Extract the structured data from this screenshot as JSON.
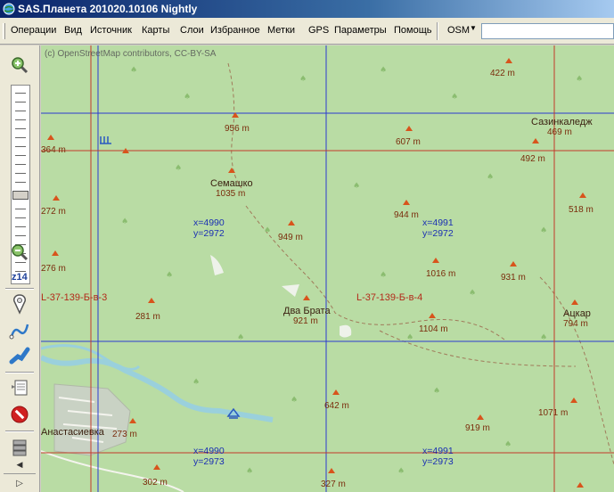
{
  "window": {
    "title": "SAS.Планета 201020.10106 Nightly"
  },
  "menu": {
    "items": [
      "Операции",
      "Вид",
      "Источник",
      "Карты",
      "Слои",
      "Избранное",
      "Метки",
      "GPS",
      "Параметры",
      "Помощь"
    ],
    "map_source": "OSM",
    "search_placeholder": ""
  },
  "toolbar": {
    "zoom_level": "z14",
    "buttons": [
      "zoom-in-icon",
      "zoom-out-icon",
      "marker-icon",
      "path-icon",
      "measure-icon",
      "notes-icon",
      "forbidden-icon",
      "layers-icon"
    ]
  },
  "map": {
    "attribution": "(c) OpenStreetMap contributors, CC-BY-SA",
    "colors": {
      "land": "#b9dca4",
      "grid_blue": "#2a3ad0",
      "grid_red": "#c23a2a",
      "peak": "#d8541c",
      "water": "#9ad0dc"
    },
    "elevations": [
      "422 m",
      "956 m",
      "607 m",
      "492 m",
      "364 m",
      "1035 m",
      "272 m",
      "944 m",
      "518 m",
      "949 m",
      "276 m",
      "1016 m",
      "931 m",
      "281 m",
      "921 m",
      "1104 m",
      "794 m",
      "642 m",
      "1071 m",
      "273 m",
      "919 m",
      "302 m",
      "327 m"
    ],
    "places": [
      "Сазинкаледж",
      "469 m",
      "Семашко",
      "Два Брата",
      "Ацкар",
      "Анастасиевка"
    ],
    "sheets": [
      "L-37-139-Б-в-3",
      "L-37-139-Б-в-4"
    ],
    "grid_coords": [
      {
        "x": "x=4990",
        "y": "y=2972"
      },
      {
        "x": "x=4991",
        "y": "y=2972"
      },
      {
        "x": "x=4990",
        "y": "y=2973"
      },
      {
        "x": "x=4991",
        "y": "y=2973"
      }
    ]
  }
}
